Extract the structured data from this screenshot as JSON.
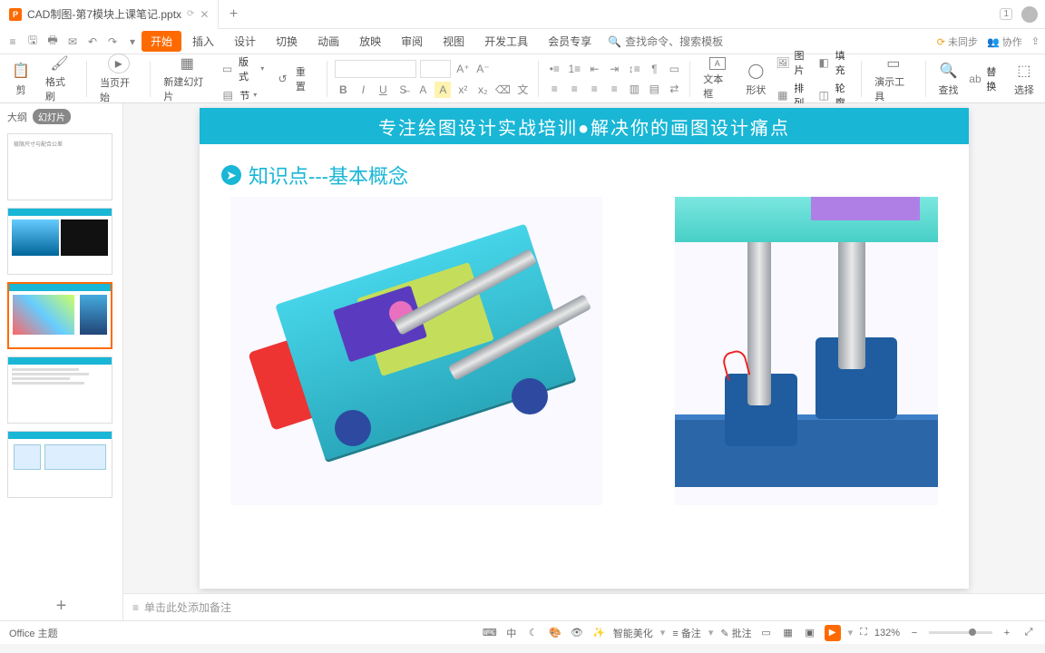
{
  "tab": {
    "doc_glyph": "P",
    "title": "CAD制图-第7模块上课笔记.pptx",
    "close": "✕"
  },
  "titlebar_right": {
    "badge": "1"
  },
  "ribbon": {
    "tabs": [
      "开始",
      "插入",
      "设计",
      "切换",
      "动画",
      "放映",
      "审阅",
      "视图",
      "开发工具",
      "会员专享"
    ],
    "active": 0,
    "search_placeholder": "查找命令、搜索模板",
    "right": {
      "sync": "未同步",
      "coop": "协作"
    }
  },
  "toolbar": {
    "paste": "剪",
    "brush": "格式刷",
    "fromStart": "当页开始",
    "newSlide": "新建幻灯片",
    "layout": "版式",
    "section": "节",
    "reset": "重置",
    "textbox": "文本框",
    "shape": "形状",
    "arrange": "排列",
    "picture": "图片",
    "fill": "填充",
    "replace_label": "轮廓",
    "presTools": "演示工具",
    "find": "查找",
    "replace": "替换",
    "select": "选择",
    "font_name": "",
    "font_size": ""
  },
  "side": {
    "outline": "大纲",
    "slides": "幻灯片"
  },
  "slide": {
    "banner": "专注绘图设计实战培训●解决你的画图设计痛点",
    "section": "知识点---基本概念"
  },
  "notes": {
    "placeholder": "单击此处添加备注"
  },
  "status": {
    "theme_prefix": "Office 主题",
    "beautify": "智能美化",
    "notes": "备注",
    "comments": "批注",
    "zoom": "132%"
  }
}
